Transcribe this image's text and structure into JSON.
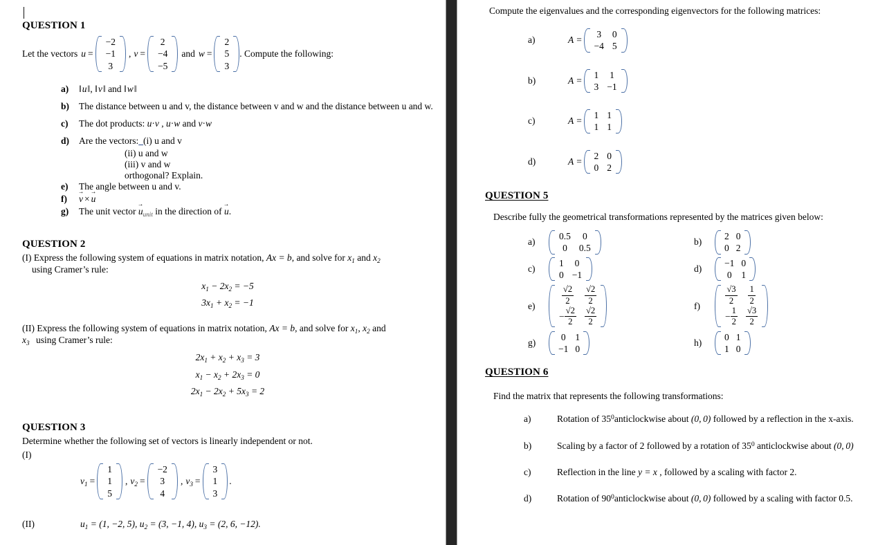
{
  "document": {
    "type": "linear-algebra-exam-worksheet",
    "columns": 2
  },
  "left_column": {
    "question1": {
      "heading": "QUESTION 1",
      "underlined": false,
      "intro_pre": "Let the vectors",
      "intro_mid1": ",",
      "intro_mid2": "and",
      "intro_post": ". Compute the following:",
      "vectors": [
        {
          "name": "u",
          "values": [
            "−2",
            "−1",
            "3"
          ]
        },
        {
          "name": "v",
          "values": [
            "2",
            "−4",
            "−5"
          ]
        },
        {
          "name": "w",
          "values": [
            "2",
            "5",
            "3"
          ]
        }
      ],
      "items": [
        {
          "label": "a)",
          "text": "‖u‖, ‖v‖ and ‖w‖"
        },
        {
          "label": "b)",
          "text": "The distance between u and v, the distance between v and w and the distance between u and w."
        },
        {
          "label": "c)",
          "text": "The dot products: u · v , u · w and v · w"
        },
        {
          "label": "d)",
          "text": "Are the vectors:"
        },
        {
          "label": "e)",
          "text": "The angle between u and v."
        },
        {
          "label": "f)",
          "text": "v × u"
        },
        {
          "label": "g)",
          "text": "The unit vector u_unit in the direction of u ."
        }
      ],
      "d_sublist": [
        "(i) u and v",
        "(ii) u and w",
        "(iii) v and w",
        "orthogonal? Explain."
      ],
      "g_parts": {
        "pre": "The unit vector",
        "vec": "u",
        "sub": "unit",
        "mid": "in the direction of",
        "vec2": "u",
        "post": "."
      }
    },
    "question2": {
      "heading": "QUESTION 2",
      "underlined": false,
      "part1_label": "(I)",
      "part1_text_a": "Express the following system of equations in matrix notation,",
      "part1_eqnote": "Ax = b",
      "part1_text_b": ", and solve for",
      "part1_vars": [
        "x₁",
        "x₂"
      ],
      "part1_text_c": "and",
      "part1_text_d": "using Cramer’s rule:",
      "system1": [
        "x₁ − 2x₂ = −5",
        "3x₁ + x₂ = −1"
      ],
      "part2_label": "(II)",
      "part2_text_a": "Express the following system of equations in matrix notation,",
      "part2_eqnote": "Ax = b",
      "part2_text_b": ", and solve for",
      "part2_vars": [
        "x₁",
        "x₂",
        "x₃"
      ],
      "part2_text_c": "and",
      "part2_text_d": "using Cramer’s rule:",
      "system2": [
        "2x₁ + x₂ + x₃ = 3",
        "x₁ − x₂ + 2x₃ = 0",
        "2x₁ − 2x₂ + 5x₃ = 2"
      ]
    },
    "question3": {
      "heading": "QUESTION 3",
      "underlined": false,
      "intro": "Determine whether the following set of vectors is linearly independent or not.",
      "part1_label": "(I)",
      "vectors": [
        {
          "name": "v",
          "index": "1",
          "values": [
            "1",
            "1",
            "5"
          ]
        },
        {
          "name": "v",
          "index": "2",
          "values": [
            "−2",
            "3",
            "4"
          ]
        },
        {
          "name": "v",
          "index": "3",
          "values": [
            "3",
            "1",
            "3"
          ]
        }
      ],
      "part2_label": "(II)",
      "part2_text": "u₁ = (1, −2, 5), u₂ = (3, −1, 4), u₃ = (2, 6, −12).",
      "part2_tuples": [
        {
          "name": "u",
          "index": "1",
          "tuple": "1, −2, 5"
        },
        {
          "name": "u",
          "index": "2",
          "tuple": "3, −1, 4"
        },
        {
          "name": "u",
          "index": "3",
          "tuple": "2, 6, −12"
        }
      ]
    }
  },
  "right_column": {
    "question4": {
      "intro": "Compute the eigenvalues and the corresponding eigenvectors for the following matrices:",
      "items": [
        {
          "label": "a)",
          "lhs": "A =",
          "rows": [
            [
              "3",
              "0"
            ],
            [
              "−4",
              "5"
            ]
          ]
        },
        {
          "label": "b)",
          "lhs": "A =",
          "rows": [
            [
              "1",
              "1"
            ],
            [
              "3",
              "−1"
            ]
          ]
        },
        {
          "label": "c)",
          "lhs": "A =",
          "rows": [
            [
              "1",
              "1"
            ],
            [
              "1",
              "1"
            ]
          ]
        },
        {
          "label": "d)",
          "lhs": "A =",
          "rows": [
            [
              "2",
              "0"
            ],
            [
              "0",
              "2"
            ]
          ]
        }
      ]
    },
    "question5": {
      "heading": "QUESTION 5",
      "underlined": true,
      "intro": "Describe fully the geometrical transformations represented by the matrices given below:",
      "items": [
        {
          "label": "a)",
          "kind": "plain",
          "rows": [
            [
              "0.5",
              "0"
            ],
            [
              "0",
              "0.5"
            ]
          ]
        },
        {
          "label": "b)",
          "kind": "plain",
          "rows": [
            [
              "2",
              "0"
            ],
            [
              "0",
              "2"
            ]
          ]
        },
        {
          "label": "c)",
          "kind": "plain",
          "rows": [
            [
              "1",
              "0"
            ],
            [
              "0",
              "−1"
            ]
          ]
        },
        {
          "label": "d)",
          "kind": "plain",
          "rows": [
            [
              "−1",
              "0"
            ],
            [
              "0",
              "1"
            ]
          ]
        },
        {
          "label": "e)",
          "kind": "frac",
          "rows": [
            [
              {
                "sign": "",
                "num": "√2",
                "den": "2"
              },
              {
                "sign": "",
                "num": "√2",
                "den": "2"
              }
            ],
            [
              {
                "sign": "−",
                "num": "√2",
                "den": "2"
              },
              {
                "sign": "",
                "num": "√2",
                "den": "2"
              }
            ]
          ]
        },
        {
          "label": "f)",
          "kind": "frac",
          "rows": [
            [
              {
                "sign": "",
                "num": "√3",
                "den": "2"
              },
              {
                "sign": "",
                "num": "1",
                "den": "2"
              }
            ],
            [
              {
                "sign": "−",
                "num": "1",
                "den": "2"
              },
              {
                "sign": "",
                "num": "√3",
                "den": "2"
              }
            ]
          ]
        },
        {
          "label": "g)",
          "kind": "plain",
          "rows": [
            [
              "0",
              "1"
            ],
            [
              "−1",
              "0"
            ]
          ]
        },
        {
          "label": "h)",
          "kind": "plain",
          "rows": [
            [
              "0",
              "1"
            ],
            [
              "1",
              "0"
            ]
          ]
        }
      ]
    },
    "question6": {
      "heading": "QUESTION 6",
      "underlined": true,
      "intro": "Find the matrix that represents the following transformations:",
      "items": [
        {
          "label": "a)",
          "text": "Rotation of 35° anticlockwise about (0, 0) followed by a reflection in the x-axis."
        },
        {
          "label": "b)",
          "text": "Scaling by a factor of 2 followed by a rotation of 35° anticlockwise about (0, 0)"
        },
        {
          "label": "c)",
          "text": "Reflection in the line y = x , followed by a scaling with factor 2."
        },
        {
          "label": "d)",
          "text": "Rotation of 90° anticlockwise about (0, 0) followed by a scaling with factor 0.5."
        }
      ]
    }
  },
  "colors": {
    "page_background": "#ffffff",
    "text": "#000000",
    "chrome_dark": "#2b2b2b",
    "matrix_bracket": "#4a6fa5"
  }
}
